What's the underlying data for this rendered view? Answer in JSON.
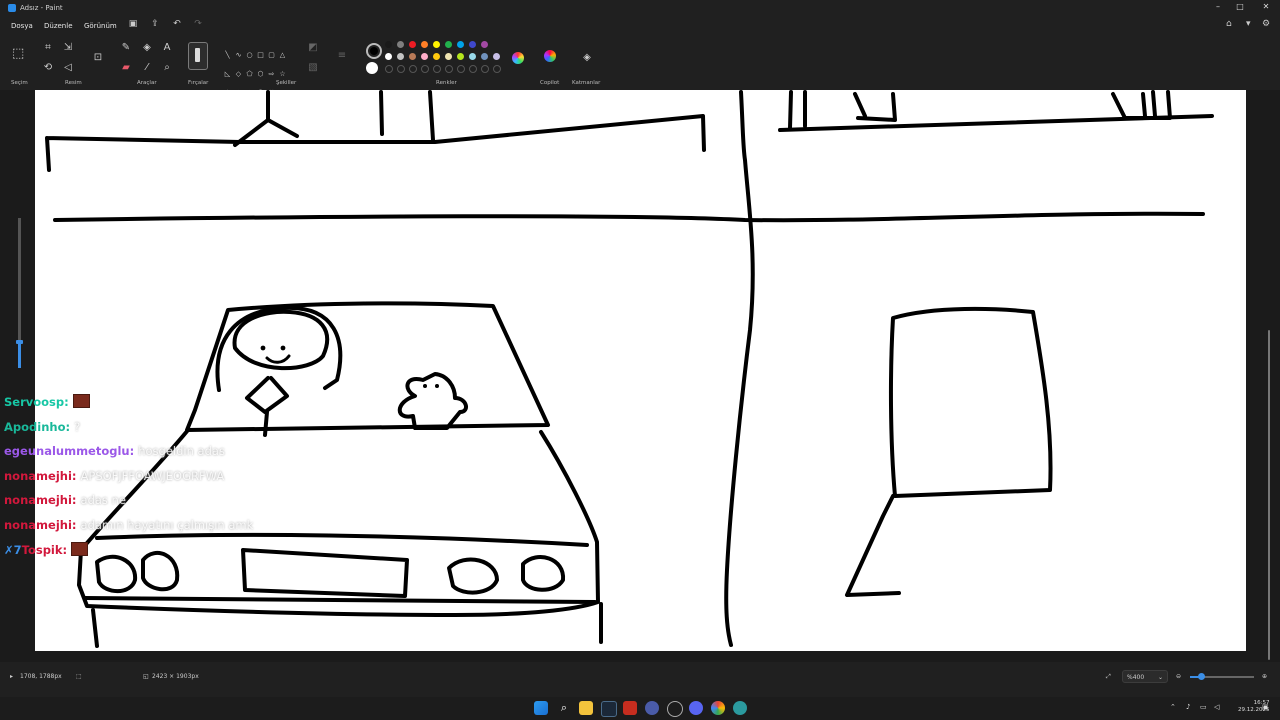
{
  "window": {
    "title": "Adsız - Paint"
  },
  "menu": {
    "file": "Dosya",
    "edit": "Düzenle",
    "view": "Görünüm"
  },
  "ribbon": {
    "selection_label": "Seçim",
    "image_label": "Resim",
    "tools_label": "Araçlar",
    "brushes_label": "Fırçalar",
    "shapes_label": "Şekiller",
    "colors_label": "Renkler",
    "copilot_label": "Copilot",
    "layers_label": "Katmanlar",
    "palette_row1": [
      "#1a1a1a",
      "#7f7f7f",
      "#ed1c24",
      "#ff7f27",
      "#fff200",
      "#22b14c",
      "#00a2e8",
      "#3f48cc",
      "#a349a4"
    ],
    "palette_row2": [
      "#ffffff",
      "#c3c3c3",
      "#b97a57",
      "#ffaec9",
      "#ffc90e",
      "#efe4b0",
      "#b5e61d",
      "#99d9ea",
      "#7092be",
      "#c8bfe7"
    ],
    "primary_color": "#000000",
    "secondary_color": "#ffffff"
  },
  "chat": [
    {
      "user": "Servoosp:",
      "color": "#17c7a5",
      "message": "",
      "emote": true
    },
    {
      "user": "Apodinho:",
      "color": "#19b89a",
      "message": "?",
      "emote": false
    },
    {
      "user": "egeunalummetoglu:",
      "color": "#9b58e8",
      "message": "hosgeldin adas",
      "emote": false
    },
    {
      "user": "nonamejhi:",
      "color": "#d2183c",
      "message": "APSOFJFFOAWJEOGRFWA",
      "emote": false
    },
    {
      "user": "nonamejhi:",
      "color": "#d2183c",
      "message": "adas ne",
      "emote": false
    },
    {
      "user": "nonamejhi:",
      "color": "#d2183c",
      "message": "adamın hayatını çalmışın amk",
      "emote": false
    },
    {
      "user": "Tospik:",
      "color": "#d2183c",
      "message": "",
      "emote": true,
      "badge": "✗7"
    }
  ],
  "status": {
    "cursor": "1708, 1788px",
    "canvas_size": "2423 × 1903px",
    "zoom": "%400"
  },
  "taskbar": {
    "time": "16:57",
    "date": "29.12.2025"
  }
}
